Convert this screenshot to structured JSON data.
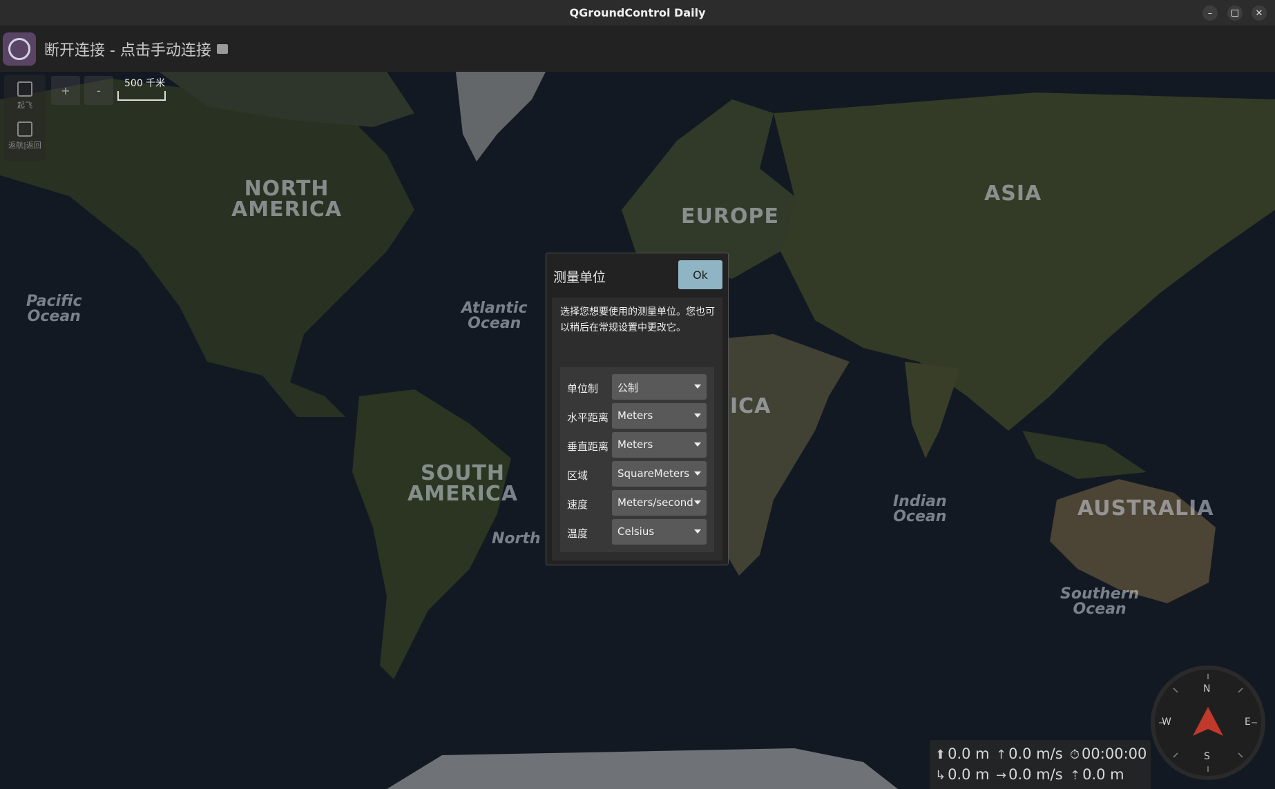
{
  "window": {
    "title": "QGroundControl Daily",
    "controls": [
      "minimize-icon",
      "maximize-icon",
      "close-icon"
    ]
  },
  "toolbar": {
    "connection_status": "断开连接 - 点击手动连接"
  },
  "map": {
    "labels": {
      "north_america": "NORTH\nAMERICA",
      "south_america": "SOUTH\nAMERICA",
      "europe": "EUROPE",
      "asia": "ASIA",
      "africa_partial": "ICA",
      "australia": "AUSTRALIA",
      "pacific": "Pacific\nOcean",
      "atlantic": "Atlantic\nOcean",
      "indian": "Indian\nOcean",
      "southern": "Southern\nOcean",
      "north_partial": "North"
    },
    "zoom_in": "+",
    "zoom_out": "-",
    "scale": "500 千米"
  },
  "tools": {
    "takeoff": "起飞",
    "return": "返航|返回"
  },
  "dialog": {
    "title": "测量单位",
    "ok": "Ok",
    "description": "选择您想要使用的测量单位。您也可以稍后在常规设置中更改它。",
    "settings": [
      {
        "label": "单位制",
        "value": "公制"
      },
      {
        "label": "水平距离",
        "value": "Meters"
      },
      {
        "label": "垂直距离",
        "value": "Meters"
      },
      {
        "label": "区域",
        "value": "SquareMeters"
      },
      {
        "label": "速度",
        "value": "Meters/second"
      },
      {
        "label": "温度",
        "value": "Celsius"
      }
    ]
  },
  "telemetry": {
    "altitude": "0.0 m",
    "vertical_speed": "0.0 m/s",
    "flight_time": "00:00:00",
    "distance": "0.0 m",
    "horizontal_speed": "0.0 m/s",
    "distance_to_home": "0.0 m"
  },
  "compass": {
    "n": "N",
    "e": "E",
    "s": "S",
    "w": "W"
  },
  "colors": {
    "ok_button": "#8fb4c4",
    "compass_pointer": "#c0392b"
  }
}
